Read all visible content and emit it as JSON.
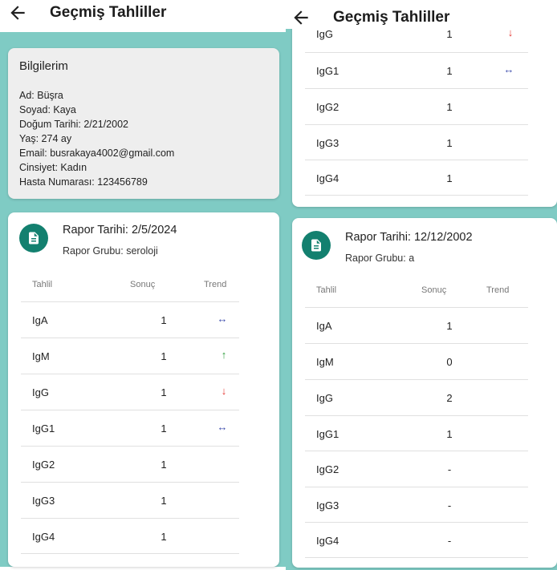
{
  "colors": {
    "background": "#7fcbc4",
    "accent": "#13806f",
    "trend_up": "#2e9e3c",
    "trend_down": "#e53935",
    "trend_same": "#3949ab"
  },
  "left": {
    "appbar": {
      "title": "Geçmiş Tahliller",
      "back_icon": "arrow-left-icon"
    },
    "info": {
      "title": "Bilgilerim",
      "lines": [
        "Ad: Büşra",
        "Soyad: Kaya",
        "Doğum Tarihi: 2/21/2002",
        "Yaş: 274 ay",
        "Email: busrakaya4002@gmail.com",
        "Cinsiyet: Kadın",
        "Hasta Numarası: 123456789"
      ]
    },
    "report": {
      "icon": "document-icon",
      "date": "Rapor Tarihi: 2/5/2024",
      "group": "Rapor Grubu: seroloji",
      "headers": [
        "Tahlil",
        "Sonuç",
        "Trend"
      ],
      "rows": [
        {
          "name": "IgA",
          "value": "1",
          "trend": "↔"
        },
        {
          "name": "IgM",
          "value": "1",
          "trend": "↑"
        },
        {
          "name": "IgG",
          "value": "1",
          "trend": "↓"
        },
        {
          "name": "IgG1",
          "value": "1",
          "trend": "↔"
        },
        {
          "name": "IgG2",
          "value": "1",
          "trend": ""
        },
        {
          "name": "IgG3",
          "value": "1",
          "trend": ""
        },
        {
          "name": "IgG4",
          "value": "1",
          "trend": ""
        }
      ]
    }
  },
  "right": {
    "appbar": {
      "title": "Geçmiş Tahliller",
      "back_icon": "arrow-left-icon"
    },
    "prev_report": {
      "rows": [
        {
          "name": "IgG",
          "value": "1",
          "trend": "↓"
        },
        {
          "name": "IgG1",
          "value": "1",
          "trend": "↔"
        },
        {
          "name": "IgG2",
          "value": "1",
          "trend": ""
        },
        {
          "name": "IgG3",
          "value": "1",
          "trend": ""
        },
        {
          "name": "IgG4",
          "value": "1",
          "trend": ""
        }
      ]
    },
    "report": {
      "icon": "document-icon",
      "date": "Rapor Tarihi: 12/12/2002",
      "group": "Rapor Grubu: a",
      "headers": [
        "Tahlil",
        "Sonuç",
        "Trend"
      ],
      "rows": [
        {
          "name": "IgA",
          "value": "1",
          "trend": ""
        },
        {
          "name": "IgM",
          "value": "0",
          "trend": ""
        },
        {
          "name": "IgG",
          "value": "2",
          "trend": ""
        },
        {
          "name": "IgG1",
          "value": "1",
          "trend": ""
        },
        {
          "name": "IgG2",
          "value": "-",
          "trend": ""
        },
        {
          "name": "IgG3",
          "value": "-",
          "trend": ""
        },
        {
          "name": "IgG4",
          "value": "-",
          "trend": ""
        }
      ]
    }
  }
}
